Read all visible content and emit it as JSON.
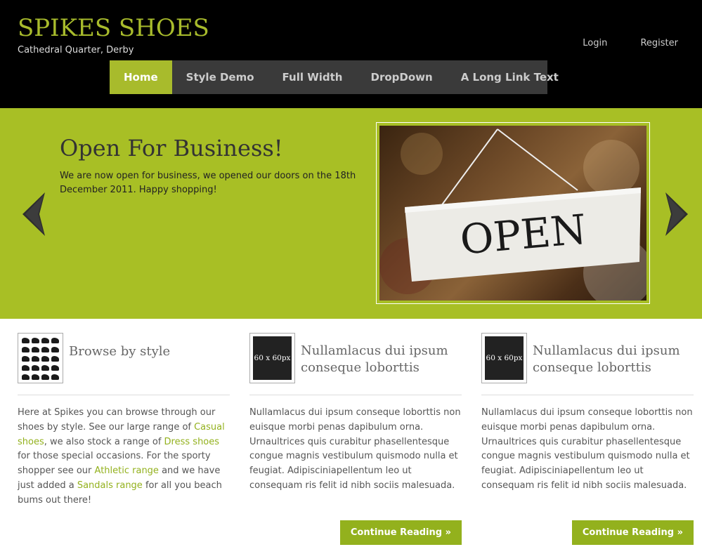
{
  "header": {
    "title": "SPIKES SHOES",
    "subtitle": "Cathedral Quarter, Derby",
    "login": "Login",
    "register": "Register"
  },
  "nav": {
    "items": [
      "Home",
      "Style Demo",
      "Full Width",
      "DropDown",
      "A Long Link Text"
    ],
    "active": "Home"
  },
  "slider": {
    "title": "Open For Business!",
    "text": "We are now open for business, we opened our doors on the 18th December 2011. Happy shopping!",
    "image_text": "OPEN",
    "prev_icon": "chevron-left-icon",
    "next_icon": "chevron-right-icon"
  },
  "columns": [
    {
      "thumb": "shoe-grid-image",
      "title": "Browse by style",
      "text_parts": [
        "Here at Spikes you can browse through our shoes by style. See our large range of ",
        "Casual shoes",
        ", we also stock a range of ",
        "Dress shoes",
        " for those special occasions. For the sporty shopper see our ",
        "Athletic range",
        " and we have just added a ",
        "Sandals range",
        " for all you beach bums out there!"
      ]
    },
    {
      "thumb": "60 x 60px",
      "title": "Nullamlacus dui ipsum conseque loborttis",
      "text": "Nullamlacus dui ipsum conseque loborttis non euisque morbi penas dapibulum orna. Urnaultrices quis curabitur phasellentesque congue magnis vestibulum quismodo nulla et feugiat. Adipisciniapellentum leo ut consequam ris felit id nibh sociis malesuada.",
      "button": "Continue Reading »"
    },
    {
      "thumb": "60 x 60px",
      "title": "Nullamlacus dui ipsum conseque loborttis",
      "text": "Nullamlacus dui ipsum conseque loborttis non euisque morbi penas dapibulum orna. Urnaultrices quis curabitur phasellentesque congue magnis vestibulum quismodo nulla et feugiat. Adipisciniapellentum leo ut consequam ris felit id nibh sociis malesuada.",
      "button": "Continue Reading »"
    }
  ],
  "colors": {
    "accent": "#a8bb2c",
    "slider_bg": "#a8bf25",
    "header_bg": "#000000",
    "nav_bg": "#3a3a3a",
    "link": "#93b11d"
  }
}
